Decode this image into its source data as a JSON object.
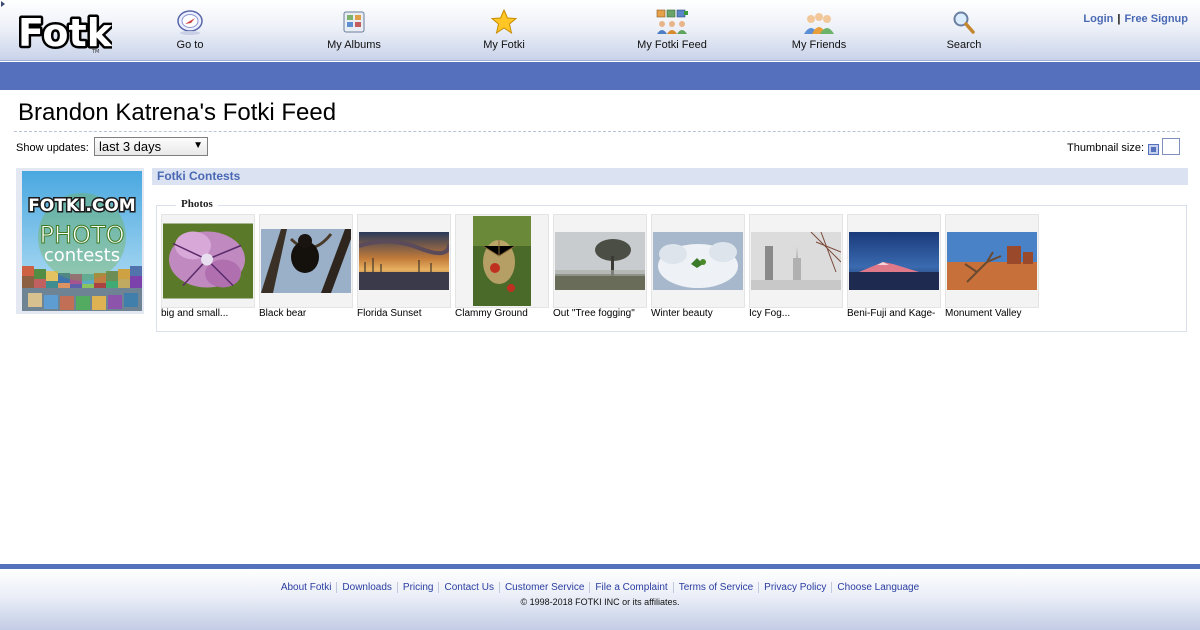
{
  "logo": {
    "text": "Fotki",
    "tm": "TM"
  },
  "nav": [
    {
      "label": "Go to",
      "icon": "compass-icon"
    },
    {
      "label": "My Albums",
      "icon": "albums-icon"
    },
    {
      "label": "My Fotki",
      "icon": "star-icon"
    },
    {
      "label": "My Fotki Feed",
      "icon": "feed-icon"
    },
    {
      "label": "My Friends",
      "icon": "friends-icon"
    },
    {
      "label": "Search",
      "icon": "magnifier-icon"
    }
  ],
  "auth": {
    "login": "Login",
    "separator": "|",
    "signup": "Free Signup"
  },
  "page": {
    "title": "Brandon Katrena's Fotki Feed"
  },
  "controls": {
    "updates_label": "Show updates:",
    "updates_value": "last 3 days",
    "thumbnail_label": "Thumbnail size:"
  },
  "feed": {
    "section_title": "Fotki Contests",
    "badge": {
      "top": "FOTKI.COM",
      "middle": "PHOTO",
      "bottom": "contests"
    },
    "photos_legend": "Photos",
    "photos": [
      {
        "caption": "big and small..."
      },
      {
        "caption": "Black bear"
      },
      {
        "caption": "Florida Sunset"
      },
      {
        "caption": "Clammy Ground"
      },
      {
        "caption": "Out \"Tree fogging\""
      },
      {
        "caption": "Winter beauty"
      },
      {
        "caption": "Icy Fog..."
      },
      {
        "caption": "Beni-Fuji and Kage-"
      },
      {
        "caption": "Monument Valley"
      }
    ]
  },
  "footer": {
    "links": [
      "About Fotki",
      "Downloads",
      "Pricing",
      "Contact Us",
      "Customer Service",
      "File a Complaint",
      "Terms of Service",
      "Privacy Policy",
      "Choose Language"
    ],
    "copyright": "© 1998-2018 FOTKI INC or its affiliates."
  },
  "colors": {
    "brand_blue": "#5570bd",
    "link_blue": "#4a69b4",
    "footer_link": "#2b3da0",
    "section_bg": "#dbe2f1"
  }
}
